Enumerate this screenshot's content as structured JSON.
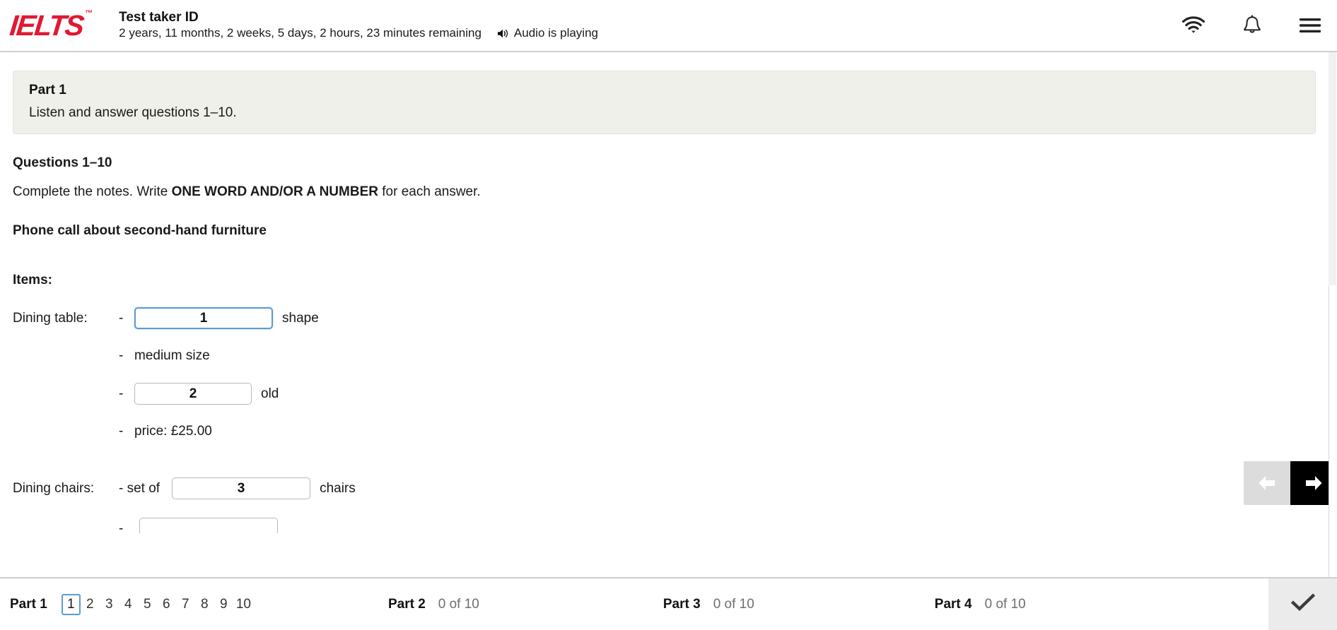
{
  "header": {
    "logo_text": "IELTS",
    "logo_tm": "™",
    "test_taker_label": "Test taker ID",
    "time_remaining": "2 years, 11 months, 2 weeks, 5 days, 2 hours, 23 minutes remaining",
    "audio_status": "Audio is playing",
    "icons": {
      "wifi": "wifi-icon",
      "bell": "bell-icon",
      "menu": "hamburger-menu-icon"
    }
  },
  "instruction": {
    "part_title": "Part 1",
    "part_text": "Listen and answer questions 1–10."
  },
  "questions": {
    "heading": "Questions 1–10",
    "instruction_pre": "Complete the notes. Write ",
    "instruction_bold": "ONE WORD AND/OR A NUMBER",
    "instruction_post": " for each answer.",
    "notes_title": "Phone call about second-hand furniture",
    "items_label": "Items:"
  },
  "notes": [
    {
      "label": "Dining table:",
      "dash": "-",
      "input_value": "1",
      "input_focused": true,
      "after": "shape"
    },
    {
      "label": "",
      "dash": "-",
      "plain": "medium size"
    },
    {
      "label": "",
      "dash": "-",
      "input_value": "2",
      "input_focused": false,
      "after": "old"
    },
    {
      "label": "",
      "dash": "-",
      "plain": "price: £25.00"
    },
    {
      "label": "Dining chairs:",
      "dash": "- set of",
      "input_value": "3",
      "input_focused": false,
      "after": "chairs"
    }
  ],
  "nav": {
    "prev_label": "previous-question",
    "next_label": "next-question"
  },
  "footer": {
    "parts": [
      {
        "name": "Part 1",
        "count": "",
        "numbers": [
          "1",
          "2",
          "3",
          "4",
          "5",
          "6",
          "7",
          "8",
          "9",
          "10"
        ],
        "current": "1"
      },
      {
        "name": "Part 2",
        "count": "0 of 10"
      },
      {
        "name": "Part 3",
        "count": "0 of 10"
      },
      {
        "name": "Part 4",
        "count": "0 of 10"
      }
    ],
    "review_icon": "checkmark-icon"
  },
  "colors": {
    "brand_red": "#e01933",
    "focus_blue": "#5b9bd1",
    "panel_bg": "#eff0ea",
    "next_btn": "#000000",
    "prev_btn": "#dcdcdc"
  }
}
